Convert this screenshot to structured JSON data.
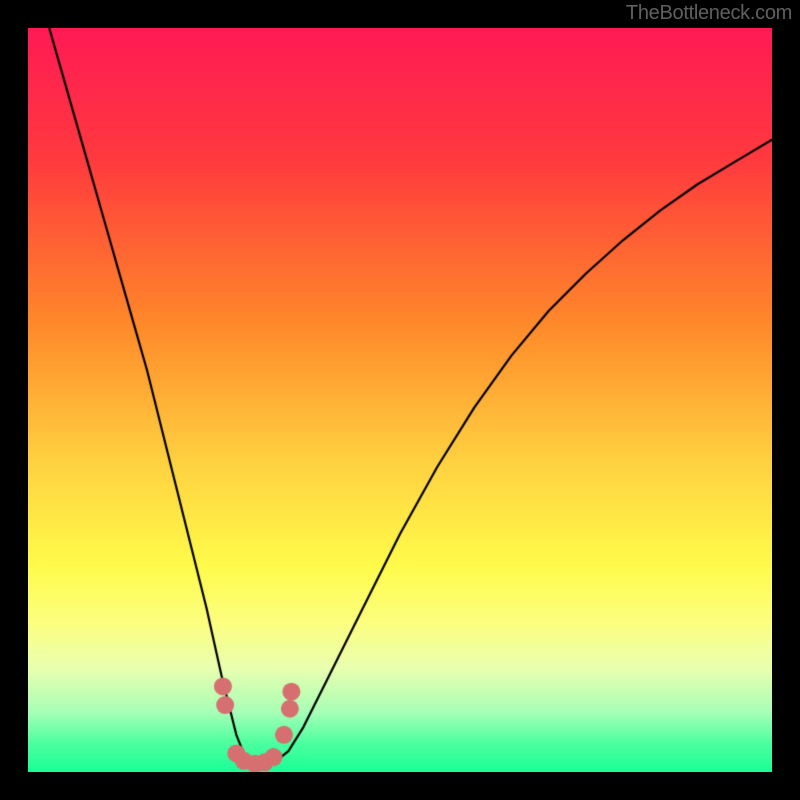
{
  "attribution": "TheBottleneck.com",
  "colors": {
    "frame": "#000000",
    "curve": "#000000",
    "markers": "#d67070",
    "gradient_stops": [
      {
        "t": 0.0,
        "color": "#ff1a55"
      },
      {
        "t": 0.18,
        "color": "#ff3b3e"
      },
      {
        "t": 0.4,
        "color": "#ff8a2a"
      },
      {
        "t": 0.58,
        "color": "#ffd040"
      },
      {
        "t": 0.72,
        "color": "#fffb4a"
      },
      {
        "t": 0.8,
        "color": "#fcff80"
      },
      {
        "t": 0.86,
        "color": "#eaffb0"
      },
      {
        "t": 0.92,
        "color": "#a6ffb6"
      },
      {
        "t": 0.96,
        "color": "#4fffa0"
      },
      {
        "t": 1.0,
        "color": "#18ff97"
      }
    ]
  },
  "chart_data": {
    "type": "line",
    "title": "",
    "xlabel": "",
    "ylabel": "",
    "xlim": [
      0,
      100
    ],
    "ylim": [
      0,
      100
    ],
    "grid": false,
    "legend": false,
    "series": [
      {
        "name": "bottleneck-curve",
        "x": [
          0,
          2,
          4,
          6,
          8,
          10,
          12,
          14,
          16,
          18,
          20,
          22,
          24,
          26,
          27,
          28,
          29,
          30,
          31,
          33,
          35,
          37,
          40,
          45,
          50,
          55,
          60,
          65,
          70,
          75,
          80,
          85,
          90,
          95,
          100
        ],
        "y": [
          110,
          103,
          96,
          89,
          82,
          75,
          68,
          61,
          54,
          46,
          38,
          30,
          22,
          13,
          9,
          5,
          2.5,
          1.4,
          1.0,
          1.2,
          2.8,
          6,
          12,
          22,
          32,
          41,
          49,
          56,
          62,
          67,
          71.5,
          75.5,
          79,
          82,
          85
        ]
      }
    ],
    "markers": {
      "name": "highlight-dots",
      "x": [
        26.2,
        26.5,
        28.0,
        29.0,
        30.5,
        31.8,
        33.0,
        34.4,
        35.2,
        35.4
      ],
      "y": [
        11.5,
        9.0,
        2.5,
        1.5,
        1.1,
        1.3,
        2.0,
        5.0,
        8.5,
        10.8
      ],
      "size": 9
    }
  }
}
